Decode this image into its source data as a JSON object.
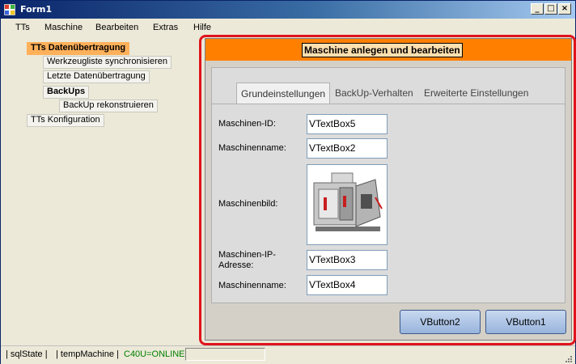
{
  "window": {
    "title": "Form1"
  },
  "menu": [
    "TTs",
    "Maschine",
    "Bearbeiten",
    "Extras",
    "Hilfe"
  ],
  "tree": {
    "nodes": [
      {
        "label": "TTs Datenübertragung",
        "selected": true
      },
      {
        "label": "Werkzeugliste synchronisieren"
      },
      {
        "label": "Letzte Datenübertragung"
      },
      {
        "label": "BackUps"
      },
      {
        "label": "BackUp rekonstruieren"
      },
      {
        "label": "TTs Konfiguration"
      }
    ]
  },
  "main": {
    "header_title": "Maschine anlegen und bearbeiten",
    "tabs": [
      "Grundeinstellungen",
      "BackUp-Verhalten",
      "Erweiterte Einstellungen"
    ],
    "active_tab": "Grundeinstellungen",
    "fields": {
      "machine_id_label": "Maschinen-ID:",
      "machine_id_value": "VTextBox5",
      "machine_name_label": "Maschinenname:",
      "machine_name_value": "VTextBox2",
      "machine_image_label": "Maschinenbild:",
      "machine_ip_label_line1": "Maschinen-IP-",
      "machine_ip_label_line2": "Adresse:",
      "machine_ip_value": "VTextBox3",
      "machine_name2_label": "Maschinenname:",
      "machine_name2_value": "VTextBox4"
    },
    "buttons": {
      "button2": "VButton2",
      "button1": "VButton1"
    }
  },
  "statusbar": {
    "sql_state": "| sqlState |",
    "temp_machine": "| tempMachine |",
    "online": "C40U=ONLINE"
  },
  "colors": {
    "header": "#ff8000",
    "selected_node": "#ffb05a",
    "highlight_frame": "#e0141c",
    "online_text": "#008000"
  }
}
